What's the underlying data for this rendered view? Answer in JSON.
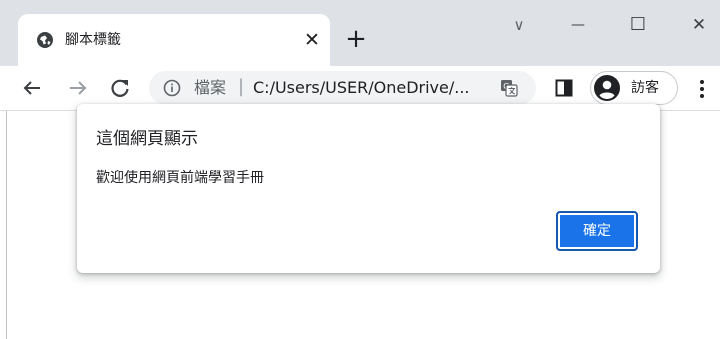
{
  "tab": {
    "title": "腳本標籤",
    "close_glyph": "✕",
    "favicon": "globe-icon"
  },
  "new_tab_glyph": "+",
  "window_controls": {
    "tab_search_glyph": "∨",
    "minimize_glyph": "—",
    "maximize_glyph": "☐",
    "close_glyph": "✕"
  },
  "toolbar": {
    "back_icon": "back-arrow-icon",
    "forward_icon": "forward-arrow-icon",
    "reload_icon": "reload-icon",
    "omnibox": {
      "info_icon": "info-icon",
      "label": "檔案",
      "separator": "|",
      "url": "C:/Users/USER/OneDrive/..."
    },
    "translate_icon": "translate-icon",
    "side_panel_icon": "side-panel-icon",
    "profile": {
      "label": "訪客",
      "icon": "guest-avatar-icon"
    },
    "menu_icon": "kebab-menu-icon"
  },
  "dialog": {
    "title": "這個網頁顯示",
    "message": "歡迎使用網頁前端學習手冊",
    "ok_label": "確定"
  },
  "colors": {
    "tabstrip_bg": "#dee1e6",
    "omnibox_bg": "#f1f3f4",
    "accent": "#1a73e8"
  }
}
